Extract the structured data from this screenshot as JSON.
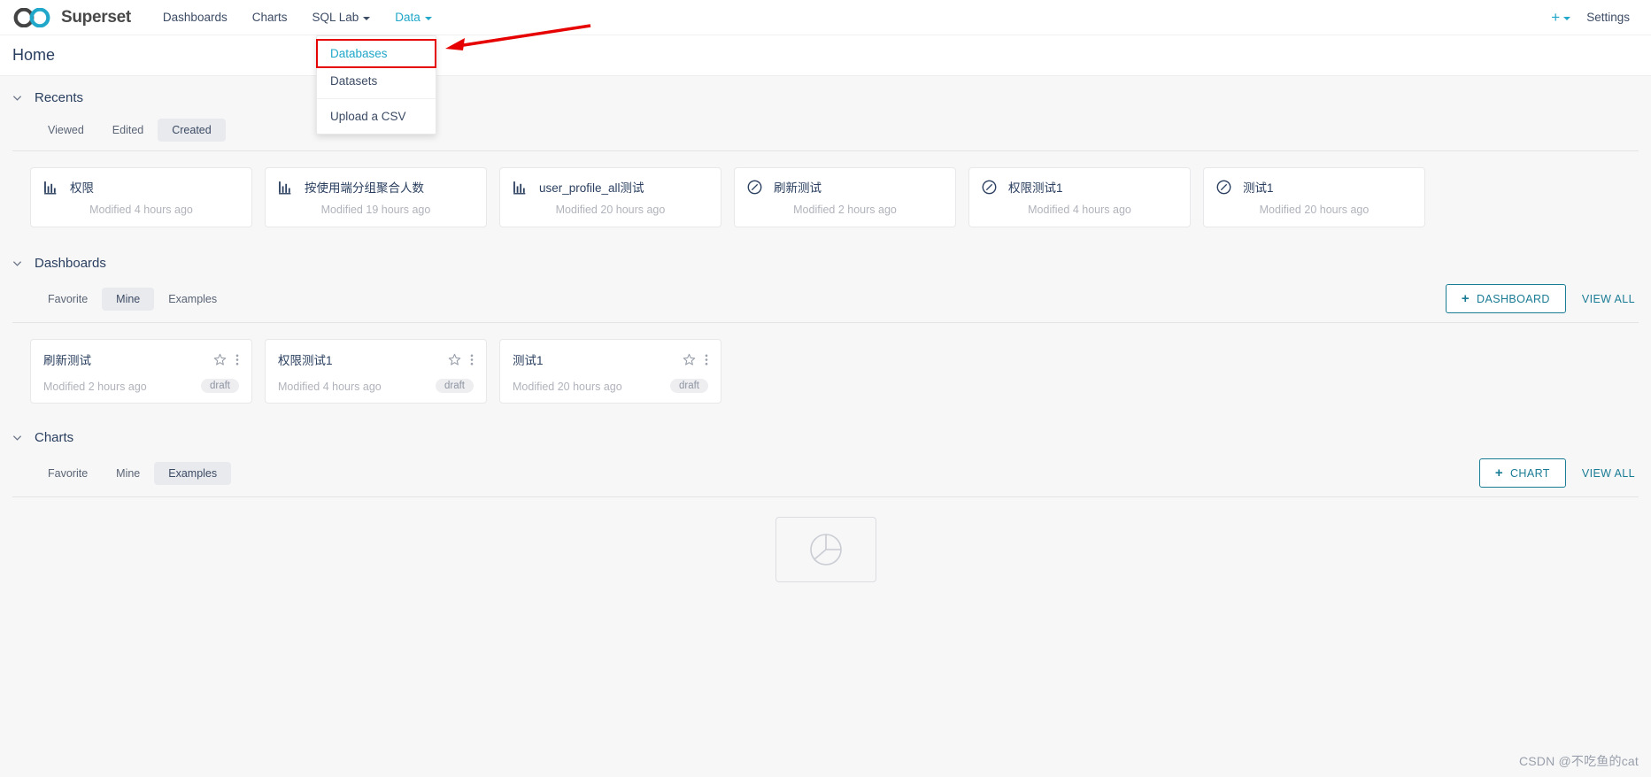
{
  "navbar": {
    "brand": "Superset",
    "items": [
      {
        "label": "Dashboards",
        "icon": "none",
        "active": false
      },
      {
        "label": "Charts",
        "icon": "none",
        "active": false
      },
      {
        "label": "SQL Lab",
        "icon": "chevron-down-icon",
        "active": false
      },
      {
        "label": "Data",
        "icon": "chevron-down-icon",
        "active": true
      }
    ],
    "right": {
      "plus_label": "+",
      "settings_label": "Settings"
    }
  },
  "dropdown": {
    "items": [
      {
        "label": "Databases",
        "highlighted": true
      },
      {
        "label": "Datasets",
        "highlighted": false
      },
      {
        "label": "Upload a CSV",
        "highlighted": false
      }
    ]
  },
  "page": {
    "title": "Home"
  },
  "recents": {
    "title": "Recents",
    "tabs": [
      {
        "label": "Viewed",
        "selected": false
      },
      {
        "label": "Edited",
        "selected": false
      },
      {
        "label": "Created",
        "selected": true
      }
    ],
    "cards": [
      {
        "title": "权限",
        "subtitle": "Modified 4 hours ago",
        "icon": "bar-chart-icon"
      },
      {
        "title": "按使用端分组聚合人数",
        "subtitle": "Modified 19 hours ago",
        "icon": "bar-chart-icon"
      },
      {
        "title": "user_profile_all测试",
        "subtitle": "Modified 20 hours ago",
        "icon": "bar-chart-icon"
      },
      {
        "title": "刷新测试",
        "subtitle": "Modified 2 hours ago",
        "icon": "dashboard-icon"
      },
      {
        "title": "权限测试1",
        "subtitle": "Modified 4 hours ago",
        "icon": "dashboard-icon"
      },
      {
        "title": "测试1",
        "subtitle": "Modified 20 hours ago",
        "icon": "dashboard-icon"
      }
    ]
  },
  "dashboards": {
    "title": "Dashboards",
    "tabs": [
      {
        "label": "Favorite",
        "selected": false
      },
      {
        "label": "Mine",
        "selected": true
      },
      {
        "label": "Examples",
        "selected": false
      }
    ],
    "add_button": "DASHBOARD",
    "view_all": "VIEW ALL",
    "cards": [
      {
        "title": "刷新测试",
        "subtitle": "Modified 2 hours ago",
        "badge": "draft"
      },
      {
        "title": "权限测试1",
        "subtitle": "Modified 4 hours ago",
        "badge": "draft"
      },
      {
        "title": "测试1",
        "subtitle": "Modified 20 hours ago",
        "badge": "draft"
      }
    ]
  },
  "charts": {
    "title": "Charts",
    "tabs": [
      {
        "label": "Favorite",
        "selected": false
      },
      {
        "label": "Mine",
        "selected": false
      },
      {
        "label": "Examples",
        "selected": true
      }
    ],
    "add_button": "CHART",
    "view_all": "VIEW ALL"
  },
  "watermark": "CSDN @不吃鱼的cat",
  "colors": {
    "accent": "#20a7c9",
    "button_border": "#1a7b94",
    "highlight_outline": "#e60000",
    "page_bg": "#f7f7f8",
    "card_bg": "#ffffff"
  }
}
